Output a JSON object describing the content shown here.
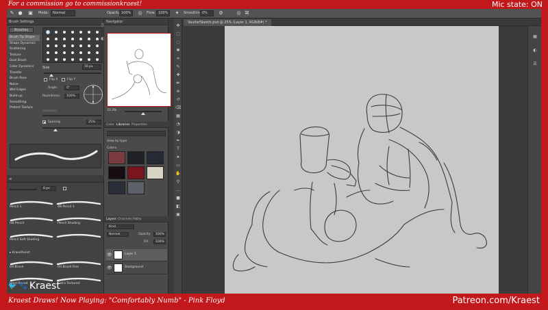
{
  "overlay": {
    "top_left": "For a commission go to commissionkraest!",
    "top_right": "Mic state: ON",
    "bottom_left": "Kraest Draws! Now Playing: \"Comfortably Numb\" - Pink Floyd",
    "bottom_right": "Patreon.com/Kraest",
    "watermark": "Kraest",
    "accent_color": "#c2181c"
  },
  "options_bar": {
    "mode_label": "Mode:",
    "mode_value": "Normal",
    "opacity_label": "Opacity:",
    "opacity_value": "100%",
    "flow_label": "Flow:",
    "flow_value": "100%",
    "smoothing_label": "Smoothing:",
    "smoothing_value": "0%"
  },
  "brush_settings": {
    "panel_title": "Brush Settings",
    "brushes_button": "Brushes",
    "items": [
      "Brush Tip Shape",
      "Shape Dynamics",
      "Scattering",
      "Texture",
      "Dual Brush",
      "Color Dynamics",
      "Transfer",
      "Brush Pose",
      "Noise",
      "Wet Edges",
      "Build-up",
      "Smoothing",
      "Protect Texture"
    ],
    "size_label": "Size",
    "size_value": "16 px",
    "flip_x": "Flip X",
    "flip_y": "Flip Y",
    "angle_label": "Angle:",
    "angle_value": "0°",
    "roundness_label": "Roundness:",
    "roundness_value": "100%",
    "hardness_label": "Hardness",
    "spacing_label": "Spacing",
    "spacing_value": "25%"
  },
  "brushes": {
    "size_value": "8 px",
    "rows": [
      {
        "left": "Pencil 1",
        "right": "4B Pencil 1"
      },
      {
        "left": "HB Pencil",
        "right": "Pencil Shading"
      },
      {
        "left": "Pencil Soft Shading",
        "right": ""
      }
    ],
    "group": "KraesPainst",
    "rows2": [
      {
        "left": "Oil Brush",
        "right": "Oil Brush Fine"
      },
      {
        "left": "Hard Round",
        "right": "Extra Textured"
      }
    ]
  },
  "navigator": {
    "title": "Navigator",
    "zoom": "33.3%"
  },
  "swatches": {
    "tabs": [
      "Color",
      "Libraries",
      "Properties"
    ],
    "active_tab": "Libraries",
    "view_by": "View by type",
    "group_title": "Colors",
    "colors": [
      "#7a3c40",
      "#212128",
      "#262a36",
      "#150d12",
      "#7a1520",
      "#d8d4c4",
      "#2a2c38",
      "#5c6068"
    ]
  },
  "layers": {
    "tabs": [
      "Layers",
      "Channels",
      "Paths"
    ],
    "kind": "Kind",
    "blend": "Normal",
    "opacity_label": "Opacity:",
    "opacity_value": "100%",
    "fill_label": "Fill:",
    "fill_value": "100%",
    "items": [
      {
        "name": "Layer 1",
        "selected": true
      },
      {
        "name": "Background",
        "selected": false
      }
    ]
  },
  "document": {
    "tab_label": "VaultarSketch.psd @ 25% (Layer 1, RGB/8#) *"
  }
}
